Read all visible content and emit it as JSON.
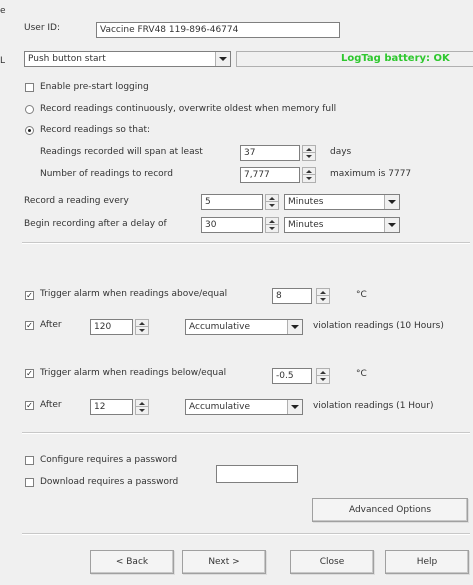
{
  "edge": {
    "label1": "e",
    "label2": "L"
  },
  "user_id": {
    "label": "User ID:",
    "value": "Vaccine FRV48 119-896-46774"
  },
  "start_mode": {
    "value": "Push button start"
  },
  "battery": {
    "text": "LogTag battery: OK",
    "color": "#2ec82e"
  },
  "options": {
    "enable_prestart": {
      "label": "Enable pre-start logging",
      "checked": false
    },
    "record_continuous": {
      "label": "Record readings continuously, overwrite oldest when memory full",
      "selected": false
    },
    "record_so_that": {
      "label": "Record readings so that:",
      "selected": true
    }
  },
  "span": {
    "label": "Readings recorded will span at least",
    "value": "37",
    "unit": "days"
  },
  "num_readings": {
    "label": "Number of readings to record",
    "value": "7,777",
    "note": "maximum is 7777"
  },
  "interval": {
    "label": "Record a reading every",
    "value": "5",
    "unit": "Minutes"
  },
  "delay": {
    "label": "Begin recording after a delay of",
    "value": "30",
    "unit": "Minutes"
  },
  "alarm_upper": {
    "label": "Trigger alarm when readings above/equal",
    "value": "8",
    "unit": "°C",
    "after_label": "After",
    "after_value": "120",
    "mode": "Accumulative",
    "violation": "violation readings (10 Hours)"
  },
  "alarm_lower": {
    "label": "Trigger alarm when readings below/equal",
    "value": "-0.5",
    "unit": "°C",
    "after_label": "After",
    "after_value": "12",
    "mode": "Accumulative",
    "violation": "violation readings (1 Hour)"
  },
  "password": {
    "configure_label": "Configure requires a password",
    "download_label": "Download requires a password",
    "value": ""
  },
  "buttons": {
    "advanced": "Advanced Options",
    "back": "< Back",
    "next": "Next >",
    "close": "Close",
    "help": "Help"
  }
}
